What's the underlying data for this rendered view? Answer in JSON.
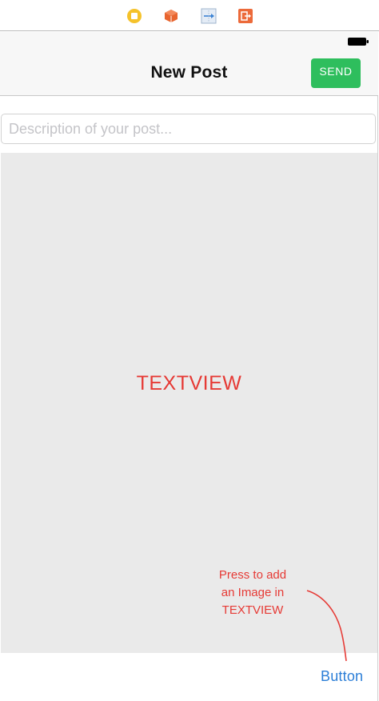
{
  "scene_dock": {
    "icons": [
      "view-controller-icon",
      "first-responder-cube-icon",
      "segue-icon",
      "exit-icon"
    ]
  },
  "nav": {
    "title": "New Post",
    "send_label": "SEND"
  },
  "description_field": {
    "placeholder": "Description of your post..."
  },
  "text_view": {
    "label": "TEXTVIEW"
  },
  "annotation": {
    "text_line1": "Press to add",
    "text_line2": "an Image in",
    "text_line3": "TEXTVIEW"
  },
  "bottom": {
    "button_label": "Button"
  },
  "colors": {
    "send_button": "#2ebe5d",
    "annotation_red": "#e63a35",
    "link_blue": "#2b7ed7",
    "text_view_bg": "#eaeaea",
    "nav_bg": "#f7f7f7"
  }
}
